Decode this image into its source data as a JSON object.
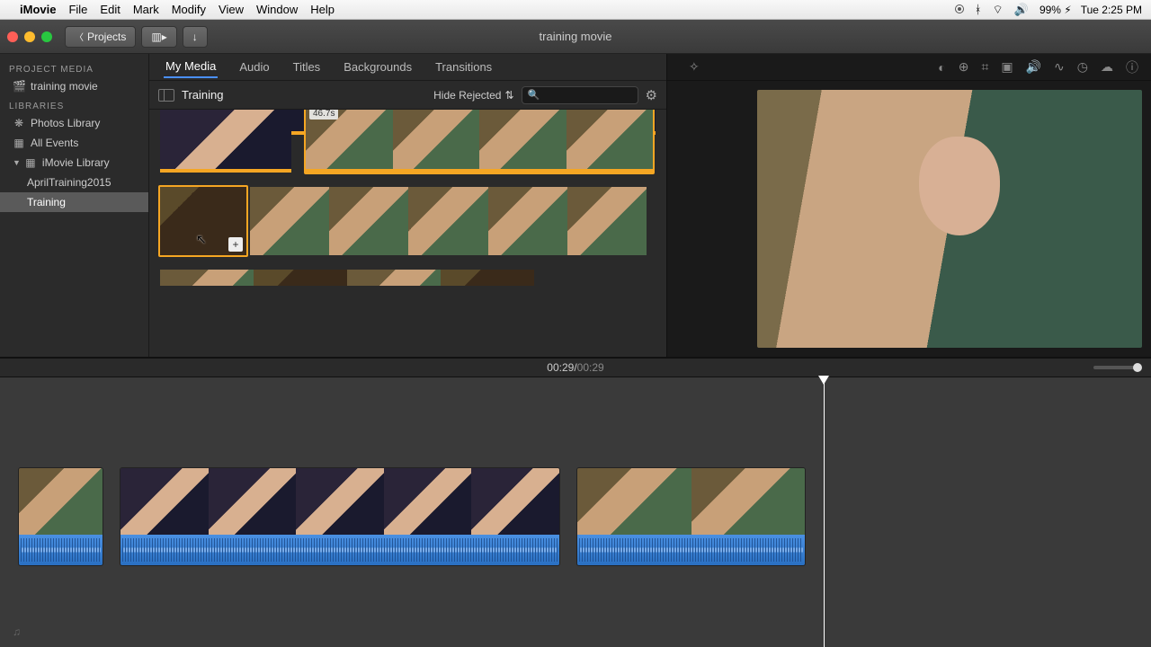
{
  "menubar": {
    "app": "iMovie",
    "items": [
      "File",
      "Edit",
      "Mark",
      "Modify",
      "View",
      "Window",
      "Help"
    ],
    "battery": "99%",
    "clock": "Tue 2:25 PM"
  },
  "toolbar": {
    "projects_label": "Projects",
    "window_title": "training movie"
  },
  "sidebar": {
    "project_media_hdr": "PROJECT MEDIA",
    "project_item": "training movie",
    "libraries_hdr": "LIBRARIES",
    "photos": "Photos Library",
    "all_events": "All Events",
    "imovie_lib": "iMovie Library",
    "child1": "AprilTraining2015",
    "child2": "Training"
  },
  "browser": {
    "tabs": [
      "My Media",
      "Audio",
      "Titles",
      "Backgrounds",
      "Transitions"
    ],
    "event_title": "Training",
    "filter_label": "Hide Rejected",
    "search_placeholder": "",
    "clip_duration": "46.7s"
  },
  "timecode": {
    "current": "00:29",
    "sep": " / ",
    "total": "00:29"
  }
}
